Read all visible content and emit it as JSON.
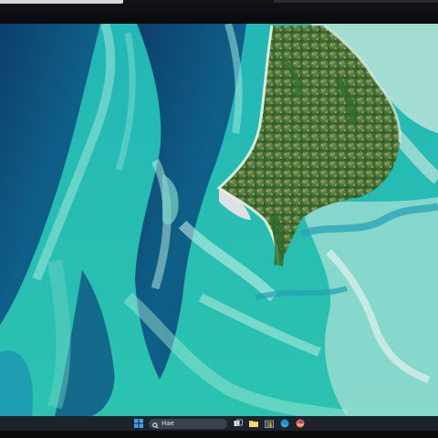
{
  "desktop": {
    "wallpaper": "aerial-coastline-turquoise-shallows",
    "colors": {
      "deep_water": "#0e4f7a",
      "shallow_water": "#1fb3ad",
      "sand": "#c8e2d6",
      "land": "#3c6a2e"
    }
  },
  "taskbar": {
    "start_icon": "windows-logo-icon",
    "search": {
      "placeholder": "Hae",
      "icon": "search-icon"
    },
    "pinned": [
      {
        "name": "task-view-icon"
      },
      {
        "name": "file-explorer-icon"
      },
      {
        "name": "microsoft-store-icon"
      },
      {
        "name": "edge-browser-icon"
      },
      {
        "name": "firefox-icon"
      }
    ]
  }
}
